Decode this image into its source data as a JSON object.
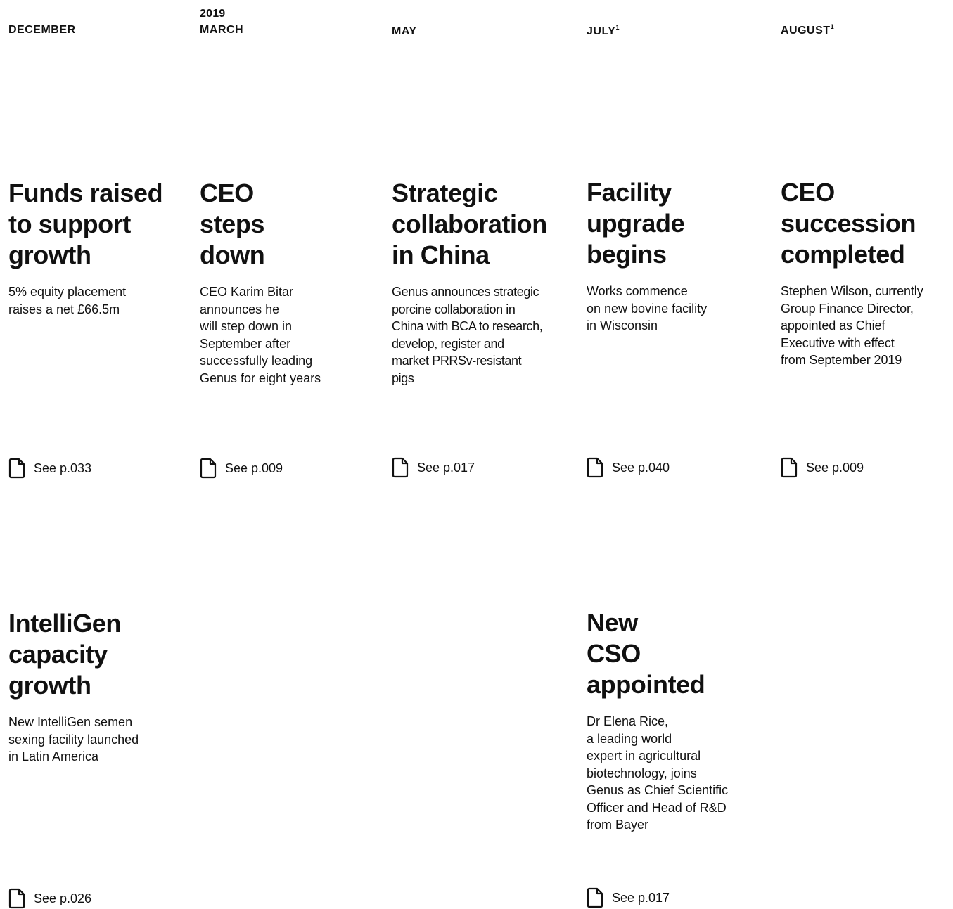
{
  "year_label": "2019",
  "columns": [
    {
      "month": "DECEMBER",
      "entries": [
        {
          "headline": "Funds raised\nto support\ngrowth",
          "description": "5% equity placement\nraises a net £66.5m",
          "ref_icon": "page-icon",
          "ref": "See p.033"
        },
        {
          "headline": "IntelliGen\ncapacity\ngrowth",
          "description": "New IntelliGen semen\nsexing facility launched\nin Latin America",
          "ref_icon": "page-icon",
          "ref": "See p.026"
        }
      ]
    },
    {
      "month": "MARCH",
      "entries": [
        {
          "headline": "CEO\nsteps\ndown",
          "description": "CEO Karim Bitar\nannounces he\nwill step down in\nSeptember after\nsuccessfully leading\nGenus for eight years",
          "ref_icon": "page-icon",
          "ref": "See p.009"
        }
      ]
    },
    {
      "month": "MAY",
      "entries": [
        {
          "headline": "Strategic\ncollaboration\nin China",
          "description": "Genus announces strategic\nporcine collaboration in\nChina with BCA to research,\ndevelop, register and\nmarket PRRSv-resistant\npigs",
          "ref_icon": "page-icon",
          "ref": "See p.017"
        }
      ]
    },
    {
      "month": "JULY",
      "footnote": "1",
      "entries": [
        {
          "headline": "Facility\nupgrade\nbegins",
          "description": "Works commence\non new bovine facility\nin Wisconsin",
          "ref_icon": "page-icon",
          "ref": "See p.040"
        },
        {
          "headline": "New\nCSO\nappointed",
          "description": "Dr Elena Rice,\na leading world\nexpert in agricultural\nbiotechnology, joins\nGenus as Chief Scientific\nOfficer and Head of R&D\nfrom Bayer",
          "ref_icon": "page-icon",
          "ref": "See p.017"
        }
      ]
    },
    {
      "month": "AUGUST",
      "footnote": "1",
      "entries": [
        {
          "headline": "CEO\nsuccession\ncompleted",
          "description": "Stephen Wilson, currently\nGroup Finance Director,\nappointed as Chief\nExecutive with effect\nfrom September 2019",
          "ref_icon": "page-icon",
          "ref": "See p.009"
        }
      ]
    }
  ]
}
